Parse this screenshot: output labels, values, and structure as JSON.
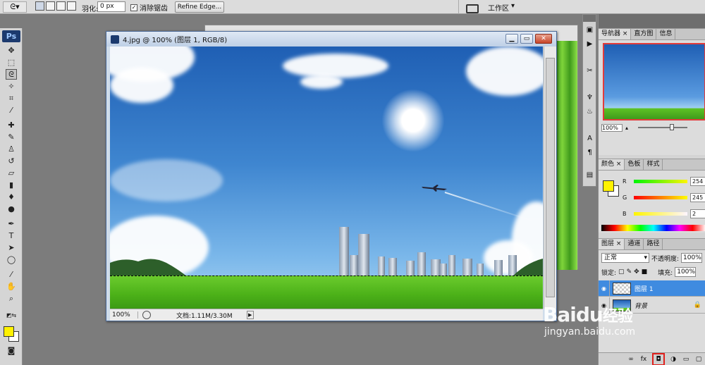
{
  "options_bar": {
    "feather_label": "羽化:",
    "feather_value": "0 px",
    "antialias_label": "消除锯齿",
    "antialias_checked": true,
    "refine_edge_label": "Refine Edge...",
    "workspace_label": "工作区"
  },
  "toolbox": {
    "logo": "Ps",
    "foreground_color": "#fff200",
    "background_color": "#ffffff",
    "tools": [
      "move-tool",
      "marquee-tool",
      "lasso-tool",
      "magic-wand-tool",
      "crop-tool",
      "eyedropper-tool",
      "healing-brush-tool",
      "brush-tool",
      "clone-stamp-tool",
      "history-brush-tool",
      "eraser-tool",
      "gradient-tool",
      "blur-tool",
      "dodge-tool",
      "pen-tool",
      "type-tool",
      "path-selection-tool",
      "shape-tool",
      "notes-tool",
      "hand-tool",
      "zoom-tool"
    ]
  },
  "document": {
    "title": "4.jpg @ 100% (图层 1, RGB/8)",
    "zoom": "100%",
    "file_info": "文档:1.11M/3.30M"
  },
  "navigator_panel": {
    "tabs": [
      "导航器",
      "直方图",
      "信息"
    ],
    "zoom": "100%"
  },
  "color_panel": {
    "tabs": [
      "颜色",
      "色板",
      "样式"
    ],
    "channels": [
      {
        "name": "R",
        "value": "254"
      },
      {
        "name": "G",
        "value": "245"
      },
      {
        "name": "B",
        "value": "2"
      }
    ],
    "foreground": "#fef502"
  },
  "layers_panel": {
    "tabs": [
      "图层",
      "通道",
      "路径"
    ],
    "blend_mode": "正常",
    "opacity_label": "不透明度:",
    "opacity_value": "100%",
    "lock_label": "锁定:",
    "fill_label": "填充:",
    "fill_value": "100%",
    "layers": [
      {
        "name": "图层 1",
        "selected": true,
        "thumb": "transparent"
      },
      {
        "name": "背景",
        "selected": false,
        "thumb": "sky"
      }
    ]
  },
  "watermark": {
    "brand": "Baidu",
    "brand_cn": "经验",
    "url": "jingyan.baidu.com"
  }
}
